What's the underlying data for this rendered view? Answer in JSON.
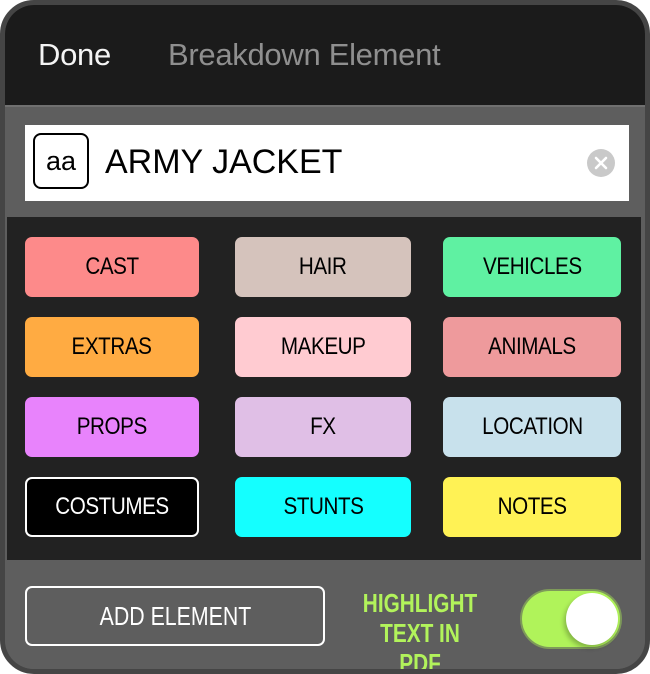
{
  "header": {
    "done_label": "Done",
    "title": "Breakdown Element"
  },
  "element_field": {
    "case_toggle_label": "aa",
    "value": "ARMY JACKET",
    "clear_icon": "clear-circle-x-icon"
  },
  "categories": [
    {
      "label": "CAST",
      "color": "#fd8a8a",
      "text_color": "#000000"
    },
    {
      "label": "HAIR",
      "color": "#d5c3bc",
      "text_color": "#000000"
    },
    {
      "label": "VEHICLES",
      "color": "#5ff1a2",
      "text_color": "#000000"
    },
    {
      "label": "EXTRAS",
      "color": "#ffab42",
      "text_color": "#000000"
    },
    {
      "label": "MAKEUP",
      "color": "#ffcbd1",
      "text_color": "#000000"
    },
    {
      "label": "ANIMALS",
      "color": "#ee9a9c",
      "text_color": "#000000"
    },
    {
      "label": "PROPS",
      "color": "#e883fc",
      "text_color": "#000000"
    },
    {
      "label": "FX",
      "color": "#e0bfe6",
      "text_color": "#000000"
    },
    {
      "label": "LOCATION",
      "color": "#c8e1ec",
      "text_color": "#000000"
    },
    {
      "label": "COSTUMES",
      "color": "#000000",
      "text_color": "#ffffff",
      "selected": true
    },
    {
      "label": "STUNTS",
      "color": "#14ffff",
      "text_color": "#000000"
    },
    {
      "label": "NOTES",
      "color": "#fff255",
      "text_color": "#000000"
    }
  ],
  "footer": {
    "add_element_label": "ADD ELEMENT",
    "highlight_label_line1": "HIGHLIGHT",
    "highlight_label_line2": "TEXT IN PDF",
    "highlight_toggle_on": true,
    "highlight_color": "#b2f35b"
  }
}
